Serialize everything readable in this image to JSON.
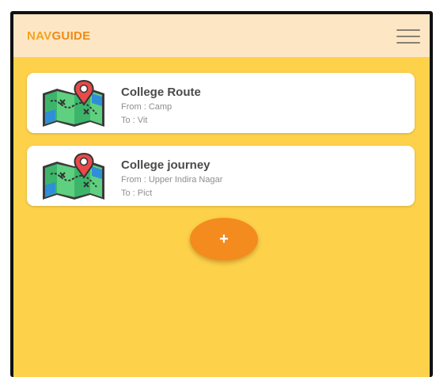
{
  "app": {
    "brand_part1": "NAV",
    "brand_part2": "GUIDE"
  },
  "routes": [
    {
      "title": "College Route",
      "from": "From : Camp",
      "to": "To : Vit",
      "icon": "map-icon"
    },
    {
      "title": "College journey",
      "from": "From : Upper Indira Nagar",
      "to": "To : Pict",
      "icon": "map-icon"
    }
  ],
  "fab": {
    "label": "+"
  },
  "colors": {
    "background": "#fdd24a",
    "appbar": "#fde6c4",
    "accent": "#f48b1f",
    "card": "#ffffff"
  }
}
